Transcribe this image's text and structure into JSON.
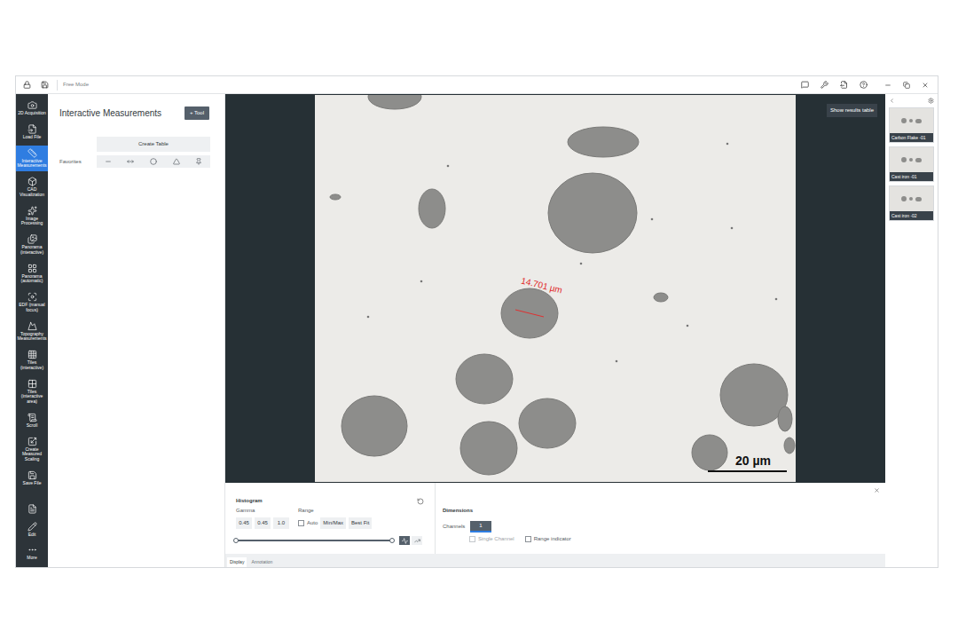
{
  "window": {
    "title": "Free Mode"
  },
  "sidebar": {
    "items": [
      {
        "label": "2D Acquisition",
        "selected": false
      },
      {
        "label": "Load File",
        "selected": false
      },
      {
        "label": "Interactive Measurements",
        "selected": true
      },
      {
        "label": "CAD Visualization",
        "selected": false
      },
      {
        "label": "Image Processing",
        "selected": false
      },
      {
        "label": "Panorama (interactive)",
        "selected": false
      },
      {
        "label": "Panorama (automatic)",
        "selected": false
      },
      {
        "label": "EDF (manual focus)",
        "selected": false
      },
      {
        "label": "Topography Measurements",
        "selected": false
      },
      {
        "label": "Tiles (interactive)",
        "selected": false
      },
      {
        "label": "Tiles (interactive area)",
        "selected": false
      },
      {
        "label": "Scroll",
        "selected": false
      },
      {
        "label": "Create Measured Scaling",
        "selected": false
      },
      {
        "label": "Save File",
        "selected": false
      }
    ],
    "bottom_items": [
      {
        "label": "",
        "selected": false
      },
      {
        "label": "Edit",
        "selected": false
      },
      {
        "label": "More",
        "selected": false
      }
    ]
  },
  "measurement_panel": {
    "title": "Interactive Measurements",
    "add_button": "+ Tool",
    "create_table_button": "Create Table",
    "favorites_label": "Favorites"
  },
  "image_view": {
    "show_results_button": "Show results table",
    "measurement_label": "14.701 µm",
    "scale_bar": "20 µm"
  },
  "gallery": [
    {
      "label": "Carbon Flake -01",
      "selected": false
    },
    {
      "label": "Cast iron -01",
      "selected": false
    },
    {
      "label": "Cast iron -02",
      "selected": false
    }
  ],
  "histogram": {
    "title": "Histogram",
    "gamma_label": "Gamma",
    "gamma_fields": [
      "0.45",
      "0.45",
      "1.0"
    ],
    "range_label": "Range",
    "auto": {
      "label": "Auto",
      "checked": false
    },
    "buttons": [
      "Min/Max",
      "Best Fit"
    ],
    "slider": {
      "low_level": 0,
      "high_level": 1
    },
    "scale_buttons": [
      {
        "kind": "linear",
        "selected": true
      },
      {
        "kind": "log",
        "selected": false
      }
    ]
  },
  "dimensions": {
    "title": "Dimensions",
    "channels_label": "Channels",
    "channel": "1",
    "options": [
      {
        "label": "Single Channel",
        "checked": false,
        "disabled": true
      },
      {
        "label": "Range indicator",
        "checked": false,
        "disabled": false
      }
    ]
  },
  "bottom_tabs": [
    {
      "label": "Display",
      "selected": true
    },
    {
      "label": "Annotation",
      "selected": false
    }
  ]
}
